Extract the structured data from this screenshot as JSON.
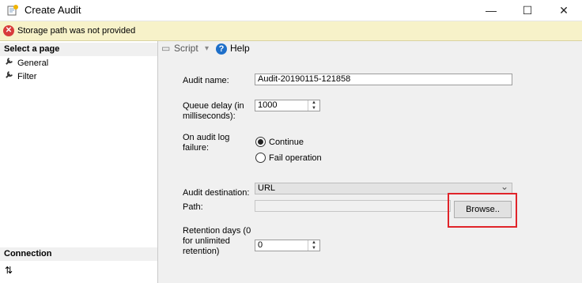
{
  "window": {
    "title": "Create Audit",
    "minimize_glyph": "—",
    "maximize_glyph": "☐",
    "close_glyph": "✕"
  },
  "error_bar": {
    "icon": "error-icon",
    "icon_glyph": "✕",
    "message": "Storage path was not provided",
    "color": "#f7f2c9"
  },
  "sidebar": {
    "select_page_header": "Select a page",
    "items": [
      {
        "label": "General",
        "icon": "wrench-icon",
        "glyph": "🔧"
      },
      {
        "label": "Filter",
        "icon": "wrench-icon",
        "glyph": "🔧"
      }
    ],
    "connection_header": "Connection",
    "connection_icon_glyph": "⇅"
  },
  "toolbar": {
    "script_label": "Script",
    "script_icon_glyph": "▭",
    "dropdown_glyph": "▾",
    "help_label": "Help",
    "help_icon_glyph": "?"
  },
  "form": {
    "audit_name_label": "Audit name:",
    "audit_name_value": "Audit-20190115-121858",
    "queue_delay_label_1": "Queue delay (in",
    "queue_delay_label_2": "milliseconds):",
    "queue_delay_value": "1000",
    "on_failure_label_1": "On audit log",
    "on_failure_label_2": "failure:",
    "options": [
      {
        "label": "Continue",
        "checked": true
      },
      {
        "label": "Fail operation",
        "checked": false
      }
    ],
    "destination_label": "Audit destination:",
    "destination_value": "URL",
    "path_label": "Path:",
    "path_value": "",
    "browse_label": "Browse..",
    "retention_label_1": "Retention days (0",
    "retention_label_2": "for unlimited",
    "retention_label_3": "retention)",
    "retention_value": "0",
    "spin_up": "▲",
    "spin_down": "▼",
    "combo_arrow": "⌄"
  },
  "colors": {
    "highlight": "#e0242a",
    "help_icon": "#1e6fc9",
    "error_icon": "#d83b3b"
  }
}
